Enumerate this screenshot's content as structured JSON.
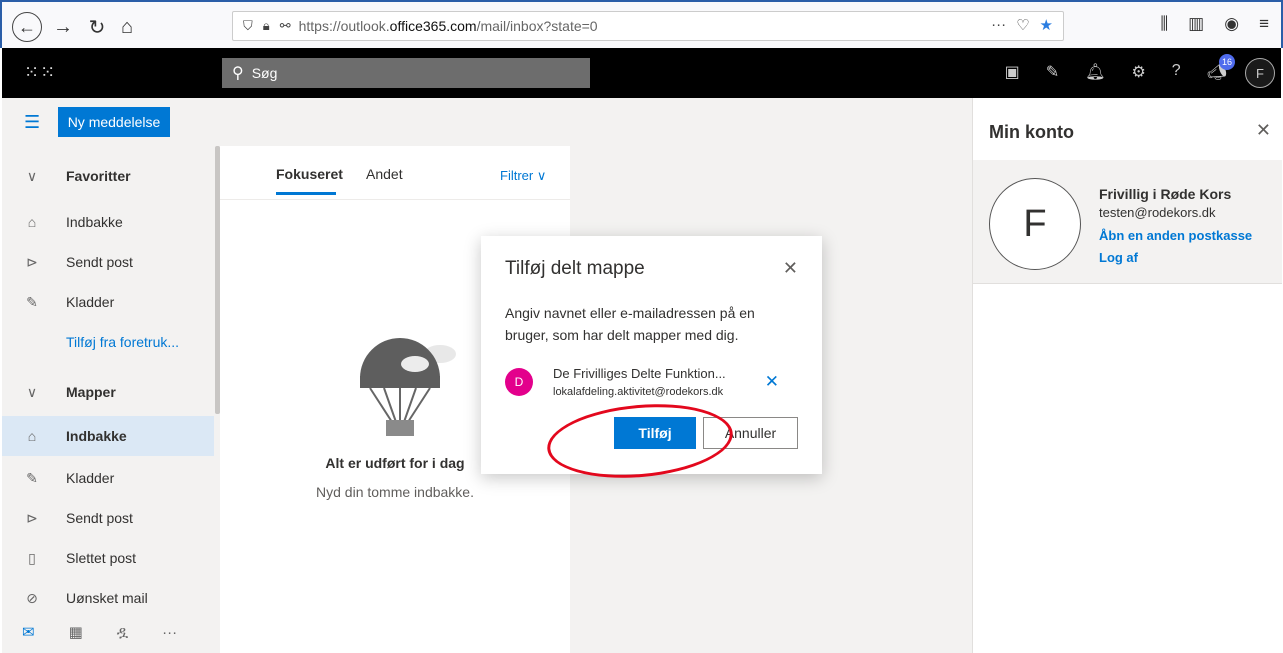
{
  "browser": {
    "url_prefix": "https://outlook.",
    "url_domain": "office365.com",
    "url_suffix": "/mail/inbox?state=0",
    "more": "···"
  },
  "topbar": {
    "search_placeholder": "Søg",
    "badge_count": "16",
    "avatar_initial": "F"
  },
  "command": {
    "new_message": "Ny meddelelse"
  },
  "nav": {
    "favorites_header": "Favoritter",
    "favorites": [
      "Indbakke",
      "Sendt post",
      "Kladder"
    ],
    "add_favorite": "Tilføj fra foretruk...",
    "folders_header": "Mapper",
    "folders": [
      "Indbakke",
      "Kladder",
      "Sendt post",
      "Slettet post",
      "Uønsket mail"
    ]
  },
  "list": {
    "tab_focused": "Fokuseret",
    "tab_other": "Andet",
    "filter": "Filtrer",
    "empty_title": "Alt er udført for i dag",
    "empty_sub": "Nyd din tomme indbakke."
  },
  "account_panel": {
    "title": "Min konto",
    "initial": "F",
    "name": "Frivillig i Røde Kors",
    "email": "testen@rodekors.dk",
    "open_other": "Åbn en anden postkasse",
    "sign_out": "Log af"
  },
  "dialog": {
    "title": "Tilføj delt mappe",
    "description": "Angiv navnet eller e-mailadressen på en bruger, som har delt mapper med dig.",
    "person_initial": "D",
    "person_name": "De Frivilliges Delte Funktion...",
    "person_email": "lokalafdeling.aktivitet@rodekors.dk",
    "add_button": "Tilføj",
    "cancel_button": "Annuller"
  },
  "colors": {
    "accent": "#0078d4",
    "person_avatar": "#e3008c",
    "annotation": "#e3081d"
  }
}
